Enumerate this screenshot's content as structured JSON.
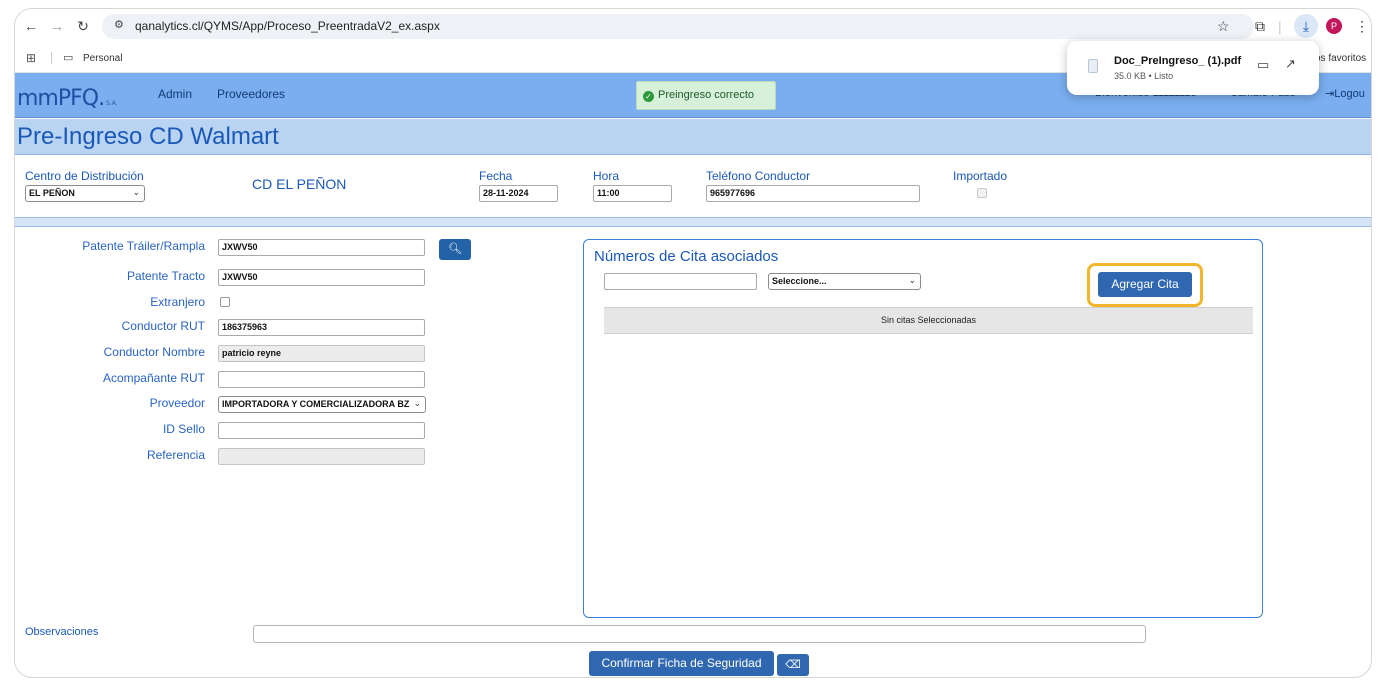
{
  "browser": {
    "url": "qanalytics.cl/QYMS/App/Proceso_PreentradaV2_ex.aspx",
    "bookmark_folder": "Personal",
    "bookmarks_right": "os favoritos",
    "avatar_letter": "P"
  },
  "download": {
    "filename": "Doc_PreIngreso_ (1).pdf",
    "meta": "35.0 KB • Listo"
  },
  "appnav": {
    "logo": "mmPFQ.",
    "logo_suffix": "S.A.",
    "links": [
      "Admin",
      "Proveedores"
    ],
    "toast": "Preingreso correcto",
    "right_1": "Bienvenido 11111113",
    "right_2": "Cambio Pass",
    "logout": "Logou"
  },
  "page_title": "Pre-Ingreso CD Walmart",
  "header": {
    "centro_label": "Centro de Distribución",
    "centro_value": "EL PEÑON",
    "centro_name": "CD EL PEÑON",
    "fecha_label": "Fecha",
    "fecha_value": "28-11-2024",
    "hora_label": "Hora",
    "hora_value": "11:00",
    "telefono_label": "Teléfono Conductor",
    "telefono_value": "965977696",
    "importado_label": "Importado"
  },
  "form": {
    "patente_trailer_label": "Patente Tráiler/Rampla",
    "patente_trailer_value": "JXWV50",
    "patente_tracto_label": "Patente Tracto",
    "patente_tracto_value": "JXWV50",
    "extranjero_label": "Extranjero",
    "conductor_rut_label": "Conductor RUT",
    "conductor_rut_value": "186375963",
    "conductor_nombre_label": "Conductor Nombre",
    "conductor_nombre_value": "patricio reyne",
    "acompanante_label": "Acompañante RUT",
    "acompanante_value": "",
    "proveedor_label": "Proveedor",
    "proveedor_value": "IMPORTADORA Y COMERCIALIZADORA BZ",
    "id_sello_label": "ID Sello",
    "id_sello_value": "",
    "referencia_label": "Referencia",
    "referencia_value": ""
  },
  "citas": {
    "title": "Números de Cita asociados",
    "input_value": "",
    "select_value": "Seleccione...",
    "add_button": "Agregar Cita",
    "empty_text": "Sin citas Seleccionadas"
  },
  "footer": {
    "observaciones_label": "Observaciones",
    "confirm_button": "Confirmar Ficha de Seguridad"
  },
  "colors": {
    "nav_bg": "#7aaef0",
    "title_bg": "#b9d3f3",
    "label_blue": "#1b59b8",
    "button_blue": "#2f68b0",
    "highlight": "#f0b72c",
    "toast_bg": "#d6f0d9"
  }
}
